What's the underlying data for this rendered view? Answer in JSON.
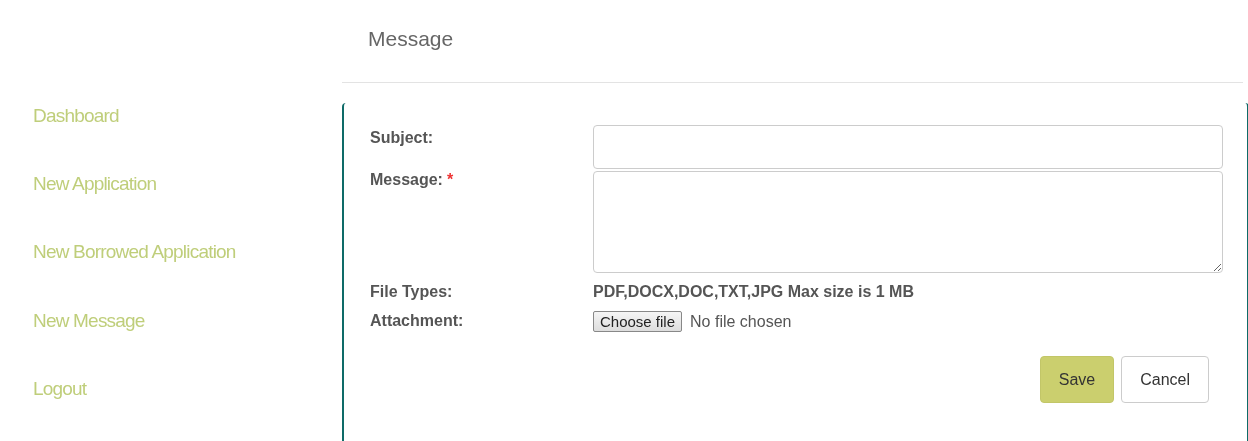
{
  "sidebar": {
    "items": [
      {
        "label": "Dashboard"
      },
      {
        "label": "New Application"
      },
      {
        "label": "New Borrowed Application"
      },
      {
        "label": "New Message"
      },
      {
        "label": "Logout"
      }
    ]
  },
  "header": {
    "title": "Message"
  },
  "form": {
    "fields": [
      {
        "kind": "input",
        "label": "Subject:",
        "required": false
      },
      {
        "kind": "textarea",
        "label": "Message:",
        "required": true,
        "required_mark": "*"
      },
      {
        "kind": "info",
        "label": "File Types:",
        "value": "PDF,DOCX,DOC,TXT,JPG Max size is 1 MB"
      },
      {
        "kind": "file",
        "label": "Attachment:",
        "button": "Choose file",
        "status": "No file chosen"
      }
    ],
    "buttons": [
      {
        "label": "Save",
        "primary": true
      },
      {
        "label": "Cancel",
        "primary": false
      }
    ]
  }
}
